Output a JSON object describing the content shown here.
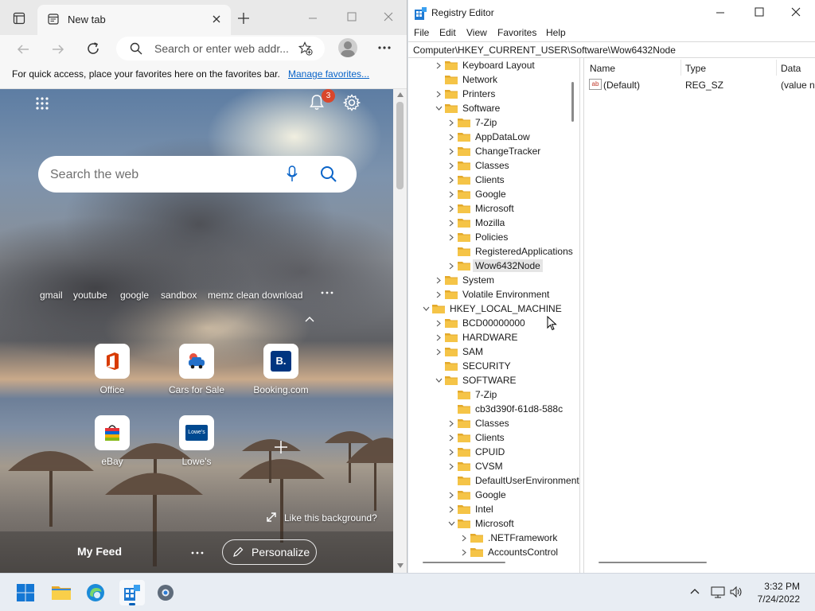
{
  "edge": {
    "tab_title": "New tab",
    "address_placeholder": "Search or enter web address",
    "address_display": "Search or enter web addr...",
    "favbar_text": "For quick access, place your favorites here on the favorites bar.",
    "favbar_link": "Manage favorites...",
    "notification_count": "3",
    "search_placeholder": "Search the web",
    "quick_links": [
      "gmail",
      "youtube",
      "google",
      "sandbox",
      "memz clean download"
    ],
    "tiles": [
      {
        "label": "Office",
        "icon": "office-icon"
      },
      {
        "label": "Cars for Sale",
        "icon": "car-icon"
      },
      {
        "label": "Booking.com",
        "icon": "booking-icon",
        "glyph": "B."
      },
      {
        "label": "eBay",
        "icon": "ebay-bag-icon"
      },
      {
        "label": "Lowe's",
        "icon": "lowes-icon",
        "glyph": "Lowe's"
      }
    ],
    "background_caption": "Like this background?",
    "my_feed": "My Feed",
    "personalize": "Personalize"
  },
  "regedit": {
    "title": "Registry Editor",
    "menu": [
      "File",
      "Edit",
      "View",
      "Favorites",
      "Help"
    ],
    "address": "Computer\\HKEY_CURRENT_USER\\Software\\Wow6432Node",
    "columns": [
      "Name",
      "Type",
      "Data"
    ],
    "values": [
      {
        "name": "(Default)",
        "type": "REG_SZ",
        "data": "(value n"
      }
    ],
    "tree": [
      {
        "label": "Keyboard Layout",
        "level": 1,
        "chev": ">"
      },
      {
        "label": "Network",
        "level": 1,
        "chev": ""
      },
      {
        "label": "Printers",
        "level": 1,
        "chev": ">"
      },
      {
        "label": "Software",
        "level": 1,
        "chev": "v"
      },
      {
        "label": "7-Zip",
        "level": 2,
        "chev": ">"
      },
      {
        "label": "AppDataLow",
        "level": 2,
        "chev": ">"
      },
      {
        "label": "ChangeTracker",
        "level": 2,
        "chev": ">"
      },
      {
        "label": "Classes",
        "level": 2,
        "chev": ">"
      },
      {
        "label": "Clients",
        "level": 2,
        "chev": ">"
      },
      {
        "label": "Google",
        "level": 2,
        "chev": ">"
      },
      {
        "label": "Microsoft",
        "level": 2,
        "chev": ">"
      },
      {
        "label": "Mozilla",
        "level": 2,
        "chev": ">"
      },
      {
        "label": "Policies",
        "level": 2,
        "chev": ">"
      },
      {
        "label": "RegisteredApplications",
        "level": 2,
        "chev": ""
      },
      {
        "label": "Wow6432Node",
        "level": 2,
        "chev": ">",
        "selected": true
      },
      {
        "label": "System",
        "level": 1,
        "chev": ">"
      },
      {
        "label": "Volatile Environment",
        "level": 1,
        "chev": ">"
      },
      {
        "label": "HKEY_LOCAL_MACHINE",
        "level": 0,
        "chev": "v"
      },
      {
        "label": "BCD00000000",
        "level": 1,
        "chev": ">"
      },
      {
        "label": "HARDWARE",
        "level": 1,
        "chev": ">"
      },
      {
        "label": "SAM",
        "level": 1,
        "chev": ">"
      },
      {
        "label": "SECURITY",
        "level": 1,
        "chev": ""
      },
      {
        "label": "SOFTWARE",
        "level": 1,
        "chev": "v"
      },
      {
        "label": "7-Zip",
        "level": 2,
        "chev": ""
      },
      {
        "label": "cb3d390f-61d8-588c",
        "level": 2,
        "chev": ""
      },
      {
        "label": "Classes",
        "level": 2,
        "chev": ">"
      },
      {
        "label": "Clients",
        "level": 2,
        "chev": ">"
      },
      {
        "label": "CPUID",
        "level": 2,
        "chev": ">"
      },
      {
        "label": "CVSM",
        "level": 2,
        "chev": ">"
      },
      {
        "label": "DefaultUserEnvironment",
        "level": 2,
        "chev": ""
      },
      {
        "label": "Google",
        "level": 2,
        "chev": ">"
      },
      {
        "label": "Intel",
        "level": 2,
        "chev": ">"
      },
      {
        "label": "Microsoft",
        "level": 2,
        "chev": "v"
      },
      {
        "label": ".NETFramework",
        "level": 3,
        "chev": ">"
      },
      {
        "label": "AccountsControl",
        "level": 3,
        "chev": ">"
      }
    ]
  },
  "taskbar": {
    "time": "3:32 PM",
    "date": "7/24/2022"
  },
  "colors": {
    "accent": "#005fb8",
    "folder": "#f5c447",
    "notification_badge": "#d9462b"
  }
}
